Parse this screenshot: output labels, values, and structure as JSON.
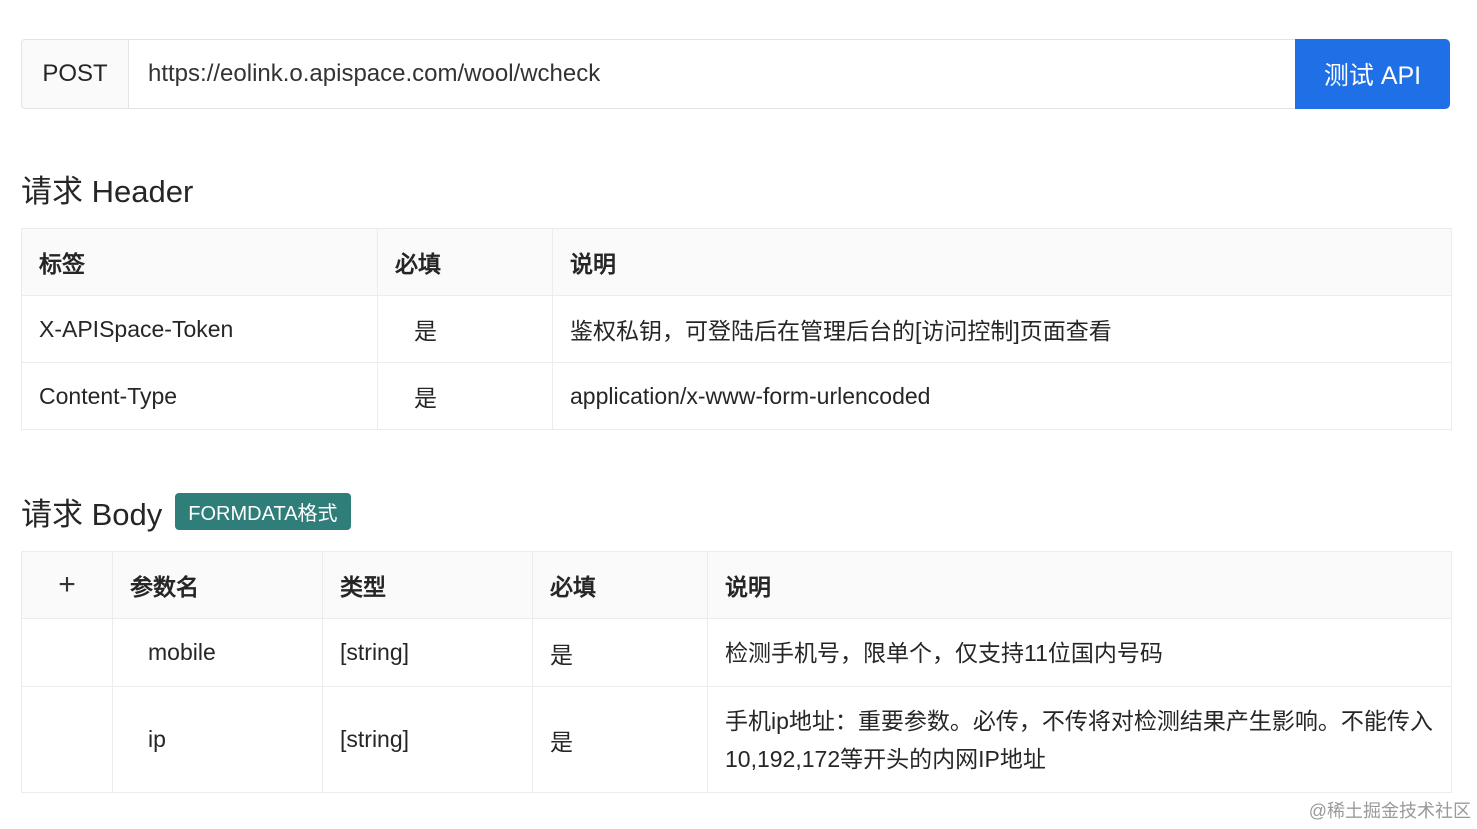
{
  "request": {
    "method": "POST",
    "url": "https://eolink.o.apispace.com/wool/wcheck",
    "test_button": "测试 API"
  },
  "header_section": {
    "title": "请求 Header",
    "columns": [
      "标签",
      "必填",
      "说明"
    ],
    "rows": [
      {
        "label": "X-APISpace-Token",
        "required": "是",
        "description": "鉴权私钥，可登陆后在管理后台的[访问控制]页面查看"
      },
      {
        "label": "Content-Type",
        "required": "是",
        "description": "application/x-www-form-urlencoded"
      }
    ]
  },
  "body_section": {
    "title": "请求 Body",
    "format_badge": "FORMDATA格式",
    "expand_symbol": "+",
    "columns": [
      "参数名",
      "类型",
      "必填",
      "说明"
    ],
    "rows": [
      {
        "name": "mobile",
        "type": "[string]",
        "required": "是",
        "description": "检测手机号，限单个，仅支持11位国内号码"
      },
      {
        "name": "ip",
        "type": "[string]",
        "required": "是",
        "description": "手机ip地址：重要参数。必传，不传将对检测结果产生影响。不能传入10,192,172等开头的内网IP地址"
      }
    ]
  },
  "watermark": "@稀土掘金技术社区"
}
